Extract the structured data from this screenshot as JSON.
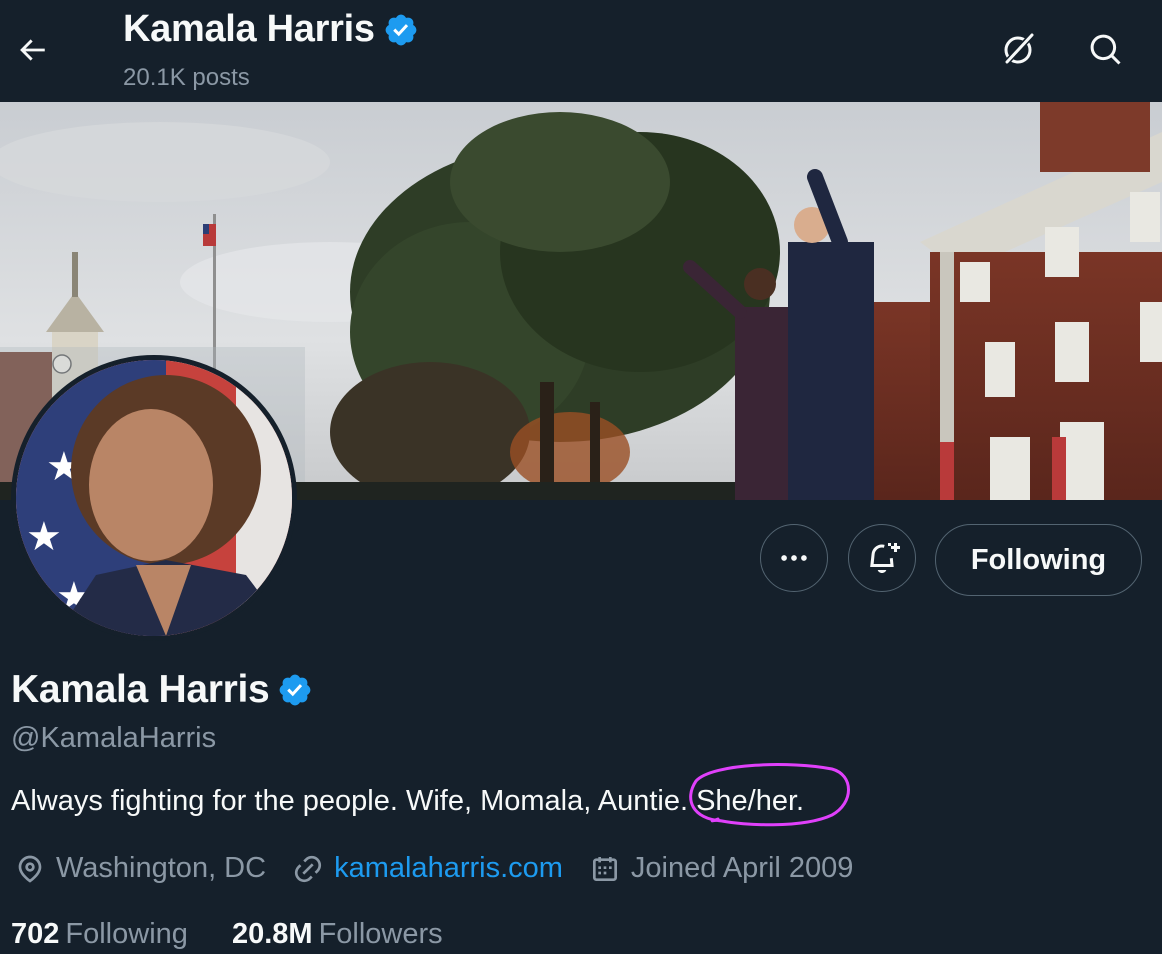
{
  "header": {
    "title": "Kamala Harris",
    "posts_count": "20.1K posts",
    "back_icon": "back-arrow-icon",
    "grok_icon": "grok-icon",
    "search_icon": "search-icon"
  },
  "profile": {
    "name": "Kamala Harris",
    "handle": "@KamalaHarris",
    "verified": true,
    "bio_text": "Always fighting for the people. Wife, Momala, Auntie. ",
    "bio_highlight": "She/her.",
    "location": "Washington, DC",
    "website": "kamalaharris.com",
    "joined": "Joined April 2009"
  },
  "actions": {
    "more_icon": "more-dots-icon",
    "notify_icon": "bell-plus-icon",
    "following_label": "Following"
  },
  "stats": {
    "following_count": "702",
    "following_label": "Following",
    "followers_count": "20.8M",
    "followers_label": "Followers"
  },
  "colors": {
    "background": "#15202b",
    "text_primary": "#f7f9f9",
    "text_secondary": "#8b98a5",
    "link": "#1d9bf0",
    "verified": "#1d9bf0",
    "annotation": "#e040fb"
  }
}
